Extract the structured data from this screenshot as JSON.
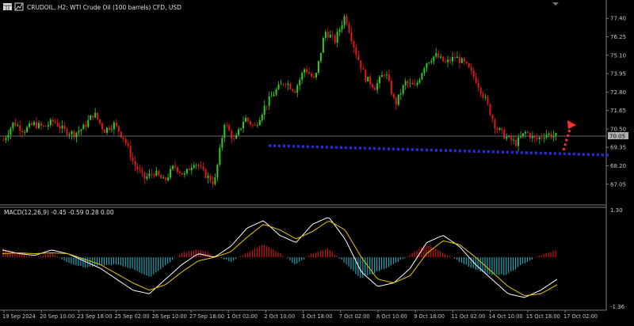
{
  "window": {
    "symbol_line": "CRUDOIL, H2:  WTI Crude Oil (100 barrels) CFD, USD"
  },
  "macd": {
    "label": "MACD(12,26,9) -0.45 -0.59 0.28 0.00"
  },
  "price_axis": {
    "current_price": "70.05",
    "current_value": 70.05,
    "min": 66.2,
    "max": 78.15,
    "ticks": [
      {
        "label": "77.40",
        "value": 77.4
      },
      {
        "label": "76.25",
        "value": 76.25
      },
      {
        "label": "75.10",
        "value": 75.1
      },
      {
        "label": "73.95",
        "value": 73.95
      },
      {
        "label": "72.80",
        "value": 72.8
      },
      {
        "label": "71.65",
        "value": 71.65
      },
      {
        "label": "70.50",
        "value": 70.5
      },
      {
        "label": "69.35",
        "value": 69.35
      },
      {
        "label": "68.20",
        "value": 68.2
      },
      {
        "label": "67.05",
        "value": 67.05
      }
    ]
  },
  "macd_axis": {
    "top": "1.30",
    "bottom": "-1.36",
    "max": 1.3,
    "min": -1.36
  },
  "time_axis": {
    "labels": [
      "19 Sep 2024",
      "20 Sep 10:00",
      "23 Sep 18:00",
      "25 Sep 02:00",
      "26 Sep 10:00",
      "27 Sep 18:00",
      "1 Oct 02:00",
      "2 Oct 10:00",
      "3 Oct 18:00",
      "7 Oct 02:00",
      "8 Oct 10:00",
      "9 Oct 18:00",
      "11 Oct 02:00",
      "14 Oct 10:00",
      "15 Oct 18:00",
      "17 Oct 02:00"
    ]
  },
  "colors": {
    "background": "#000000",
    "bull": "#2ecc1e",
    "bear": "#e01818",
    "macd_pos": "#c81414",
    "macd_neg": "#1fa3b5",
    "macd_line": "#ffffff",
    "signal_line": "#e6c800",
    "support_line": "#2a2ae0",
    "arrow": "#ff3030",
    "grid_text": "#c8c8c8",
    "price_label_bg": "#b0b0b0"
  },
  "chart_data": {
    "type": "candlestick",
    "price_path": [
      69.8,
      70.9,
      70.4,
      70.8,
      70.6,
      71.0,
      70.4,
      70.2,
      70.6,
      71.5,
      70.4,
      70.8,
      69.9,
      68.3,
      67.4,
      67.8,
      67.2,
      68.2,
      67.6,
      68.5,
      67.7,
      67.1,
      70.9,
      69.7,
      71.2,
      70.6,
      71.9,
      72.8,
      73.5,
      72.9,
      74.3,
      73.5,
      76.6,
      76.0,
      77.6,
      75.4,
      73.7,
      73.1,
      74.1,
      72.0,
      73.4,
      73.1,
      74.6,
      75.1,
      74.6,
      75.0,
      74.5,
      73.6,
      72.3,
      70.6,
      70.0,
      69.6,
      70.3,
      69.8,
      70.2,
      70.05
    ],
    "macd_path": [
      0.2,
      0.1,
      0.05,
      0.2,
      0.1,
      -0.1,
      -0.3,
      -0.6,
      -0.9,
      -1.0,
      -0.6,
      -0.2,
      0.1,
      0.0,
      0.3,
      0.8,
      1.0,
      0.6,
      0.4,
      0.9,
      1.1,
      0.5,
      -0.4,
      -0.8,
      -0.7,
      -0.3,
      0.4,
      0.6,
      0.3,
      -0.2,
      -0.6,
      -1.0,
      -1.1,
      -0.9,
      -0.6
    ],
    "signal_path": [
      0.1,
      0.12,
      0.1,
      0.12,
      0.1,
      -0.05,
      -0.2,
      -0.45,
      -0.7,
      -0.9,
      -0.75,
      -0.4,
      -0.1,
      0.0,
      0.15,
      0.55,
      0.9,
      0.75,
      0.5,
      0.7,
      1.0,
      0.75,
      0.0,
      -0.6,
      -0.7,
      -0.5,
      0.1,
      0.45,
      0.35,
      0.0,
      -0.4,
      -0.8,
      -1.05,
      -1.0,
      -0.75
    ],
    "hist_path": [
      0.22,
      0.1,
      0.0,
      0.12,
      -0.15,
      -0.28,
      -0.22,
      -0.2,
      -0.32,
      -0.55,
      -0.22,
      0.12,
      0.22,
      0.05,
      -0.12,
      0.12,
      0.35,
      0.12,
      -0.2,
      0.1,
      0.25,
      -0.15,
      -0.58,
      -0.4,
      -0.2,
      0.05,
      0.35,
      0.15,
      -0.1,
      -0.32,
      -0.48,
      -0.48,
      -0.18,
      0.05,
      0.18
    ]
  }
}
